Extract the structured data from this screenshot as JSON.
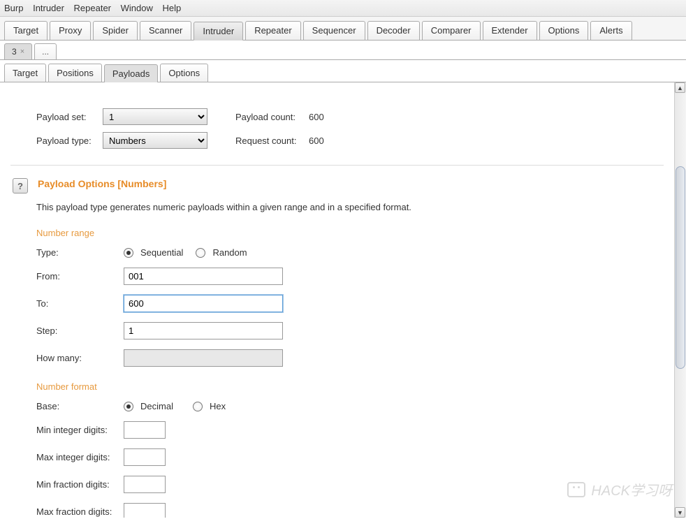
{
  "menubar": [
    "Burp",
    "Intruder",
    "Repeater",
    "Window",
    "Help"
  ],
  "main_tabs": [
    "Target",
    "Proxy",
    "Spider",
    "Scanner",
    "Intruder",
    "Repeater",
    "Sequencer",
    "Decoder",
    "Comparer",
    "Extender",
    "Options",
    "Alerts"
  ],
  "main_tab_active": "Intruder",
  "session_tabs": {
    "first": "3",
    "dots": "..."
  },
  "inner_tabs": [
    "Target",
    "Positions",
    "Payloads",
    "Options"
  ],
  "inner_tab_active": "Payloads",
  "payload_set": {
    "label": "Payload set:",
    "value": "1",
    "count_label": "Payload count:",
    "count_value": "600"
  },
  "payload_type": {
    "label": "Payload type:",
    "value": "Numbers",
    "count_label": "Request count:",
    "count_value": "600"
  },
  "section": {
    "help": "?",
    "title": "Payload Options [Numbers]",
    "desc": "This payload type generates numeric payloads within a given range and in a specified format."
  },
  "number_range": {
    "heading": "Number range",
    "type_label": "Type:",
    "type_opt1": "Sequential",
    "type_opt2": "Random",
    "from_label": "From:",
    "from_value": "001",
    "to_label": "To:",
    "to_value": "600",
    "step_label": "Step:",
    "step_value": "1",
    "how_many_label": "How many:",
    "how_many_value": ""
  },
  "number_format": {
    "heading": "Number format",
    "base_label": "Base:",
    "base_opt1": "Decimal",
    "base_opt2": "Hex",
    "min_int_label": "Min integer digits:",
    "max_int_label": "Max integer digits:",
    "min_frac_label": "Min fraction digits:",
    "max_frac_label": "Max fraction digits:"
  },
  "watermark": "HACK学习呀"
}
